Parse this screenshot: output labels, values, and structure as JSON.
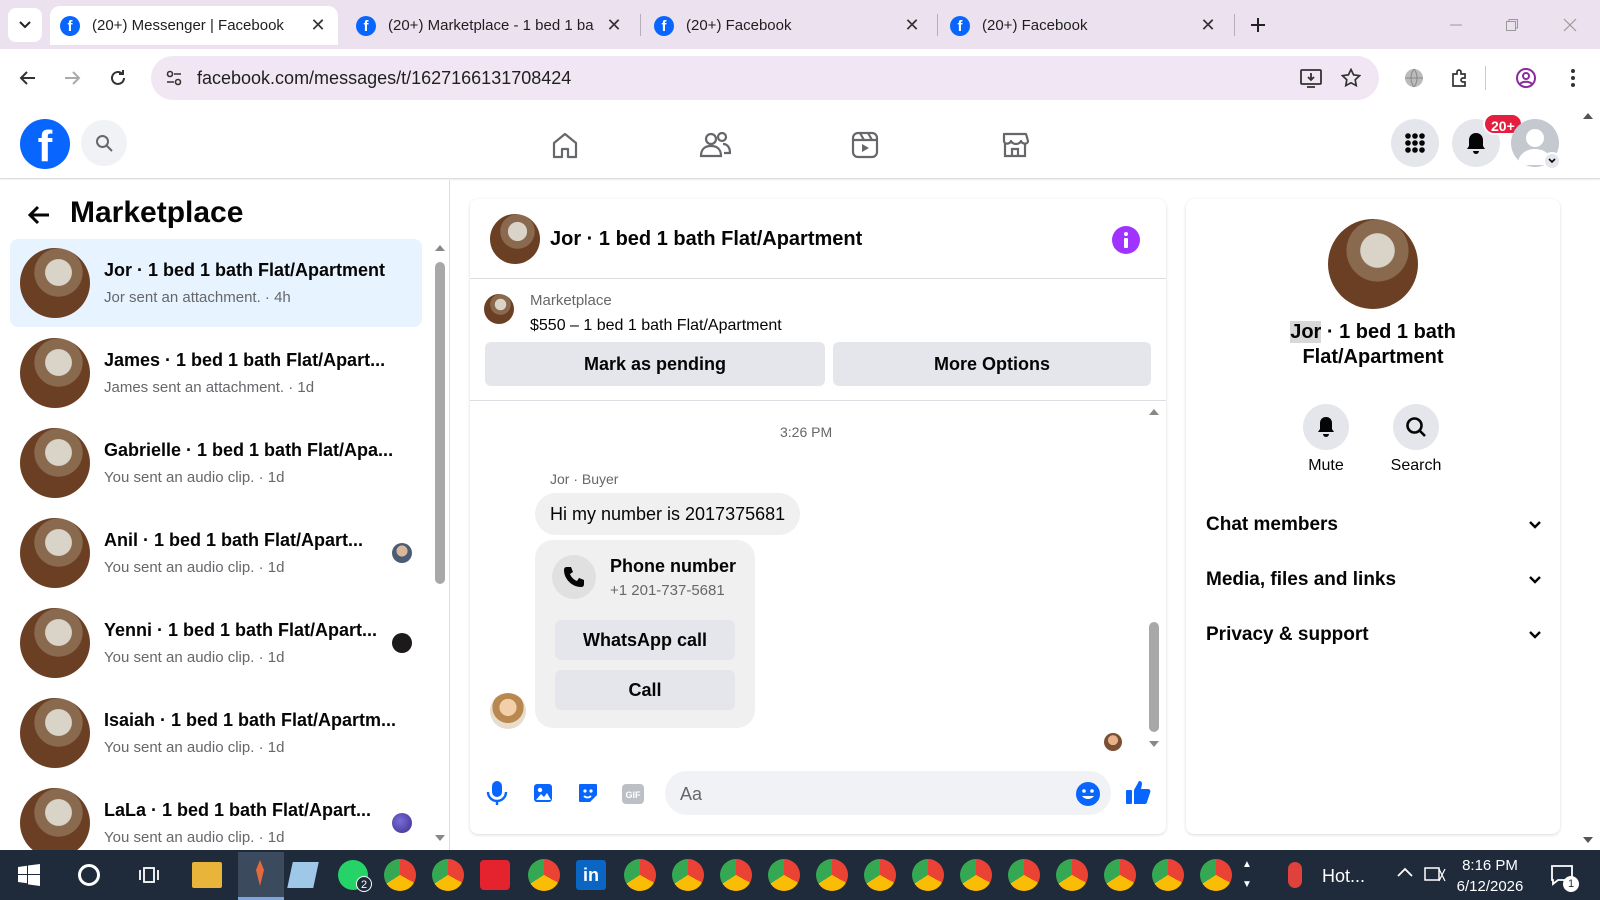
{
  "tabs": [
    {
      "title": "(20+) Messenger | Facebook",
      "active": true
    },
    {
      "title": "(20+) Marketplace - 1 bed 1 ba"
    },
    {
      "title": "(20+) Facebook"
    },
    {
      "title": "(20+) Facebook"
    }
  ],
  "url": "facebook.com/messages/t/1627166131708424",
  "notifications_badge": "20+",
  "left": {
    "title": "Marketplace",
    "conversations": [
      {
        "name": "Jor · 1 bed 1 bath Flat/Apartment",
        "sub": "Jor sent an attachment. · 4h",
        "selected": true
      },
      {
        "name": "James · 1 bed 1 bath Flat/Apart...",
        "sub": "James sent an attachment. · 1d"
      },
      {
        "name": "Gabrielle · 1 bed 1 bath Flat/Apa...",
        "sub": "You sent an audio clip. · 1d"
      },
      {
        "name": "Anil · 1 bed 1 bath Flat/Apart...",
        "sub": "You sent an audio clip. · 1d"
      },
      {
        "name": "Yenni · 1 bed 1 bath Flat/Apart...",
        "sub": "You sent an audio clip. · 1d"
      },
      {
        "name": "Isaiah · 1 bed 1 bath Flat/Apartm...",
        "sub": "You sent an audio clip. · 1d"
      },
      {
        "name": "LaLa · 1 bed 1 bath Flat/Apart...",
        "sub": "You sent an audio clip. · 1d"
      }
    ]
  },
  "chat": {
    "title": "Jor · 1 bed 1 bath Flat/Apartment",
    "listing_source": "Marketplace",
    "listing": "$550 – 1 bed 1 bath Flat/Apartment",
    "mark_pending": "Mark as pending",
    "more_options": "More Options",
    "timestamp": "3:26 PM",
    "sender": "Jor · Buyer",
    "message": "Hi my number is 2017375681",
    "card_title": "Phone number",
    "card_number": "+1 201-737-5681",
    "whatsapp": "WhatsApp call",
    "call": "Call",
    "input_placeholder": "Aa"
  },
  "right": {
    "name_highlight": "Jor",
    "name_rest": " · 1 bed 1 bath",
    "name_line2": "Flat/Apartment",
    "mute": "Mute",
    "search": "Search",
    "sections": [
      "Chat members",
      "Media, files and links",
      "Privacy & support"
    ]
  },
  "taskbar": {
    "weather": "Hot...",
    "time": "8:16 PM",
    "date": "6/12/2026",
    "whatsapp_badge": "2",
    "chat_badge": "1"
  },
  "colors": {
    "fb_blue": "#0866ff",
    "accent_purple": "#a033ff",
    "selected_row": "#e7f3ff"
  }
}
